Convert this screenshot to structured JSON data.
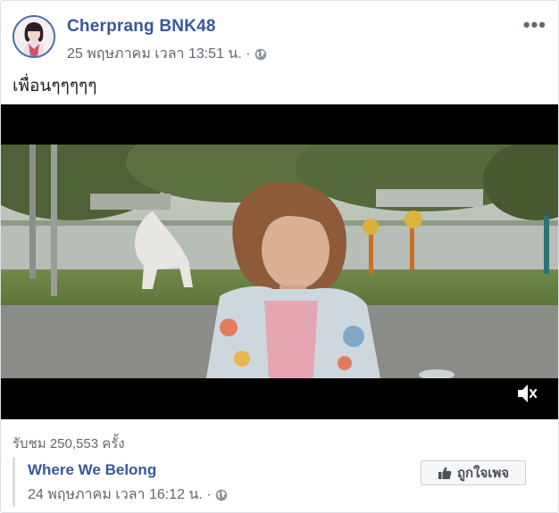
{
  "post": {
    "author": "Cherprang BNK48",
    "timestamp": "25 พฤษภาคม เวลา 13:51 น. ·",
    "text": "เพื่อนๆๆๆๆๆ",
    "more_label": "•••"
  },
  "video": {
    "views": "รับชม 250,553 ครั้ง"
  },
  "shared_page": {
    "name": "Where We Belong",
    "timestamp": "24 พฤษภาคม เวลา 16:12 น. ·",
    "like_label": "ถูกใจเพจ"
  },
  "colors": {
    "link": "#365899",
    "secondary_text": "#616770"
  },
  "icons": {
    "privacy": "globe-icon",
    "mute": "speaker-muted-icon",
    "like": "thumbs-up-icon",
    "menu": "more-options-icon"
  }
}
